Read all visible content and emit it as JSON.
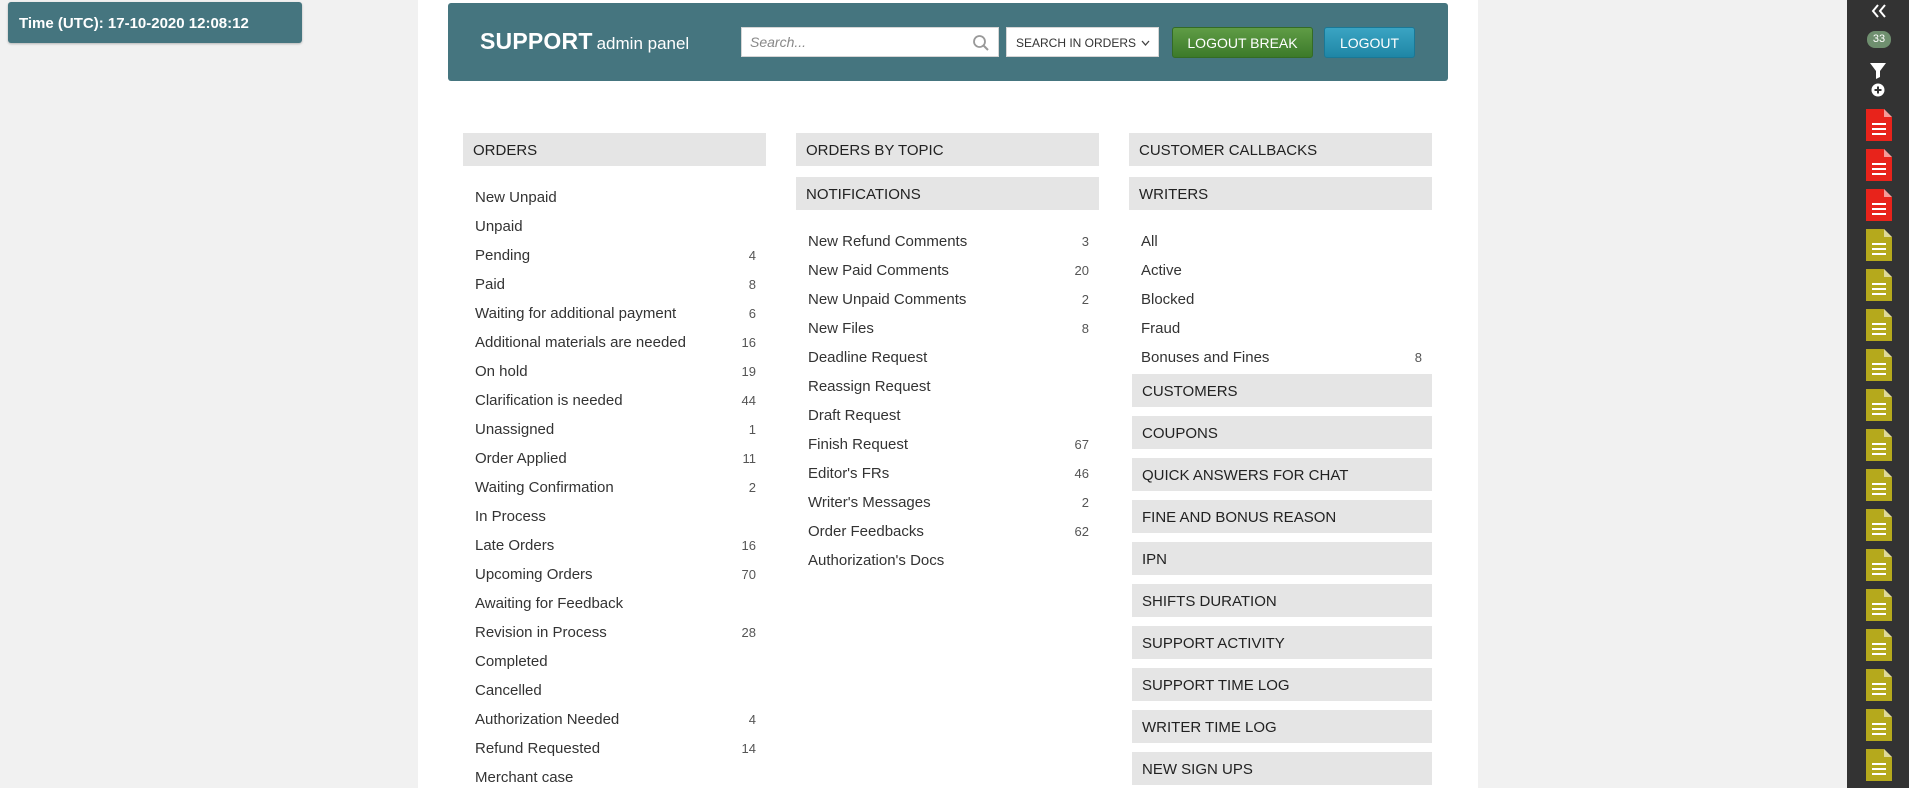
{
  "time_badge": "Time (UTC): 17-10-2020 12:08:12",
  "header": {
    "brand_main": "SUPPORT",
    "brand_sub": "admin panel",
    "search_placeholder": "Search...",
    "search_scope": "SEARCH IN ORDERS",
    "logout_break": "LOGOUT BREAK",
    "logout": "LOGOUT"
  },
  "orders": {
    "title": "ORDERS",
    "items": [
      {
        "label": "New Unpaid",
        "count": ""
      },
      {
        "label": "Unpaid",
        "count": ""
      },
      {
        "label": "Pending",
        "count": "4"
      },
      {
        "label": "Paid",
        "count": "8"
      },
      {
        "label": "Waiting for additional payment",
        "count": "6"
      },
      {
        "label": "Additional materials are needed",
        "count": "16"
      },
      {
        "label": "On hold",
        "count": "19"
      },
      {
        "label": "Clarification is needed",
        "count": "44"
      },
      {
        "label": "Unassigned",
        "count": "1"
      },
      {
        "label": "Order Applied",
        "count": "11"
      },
      {
        "label": "Waiting Confirmation",
        "count": "2"
      },
      {
        "label": "In Process",
        "count": ""
      },
      {
        "label": "Late Orders",
        "count": "16"
      },
      {
        "label": "Upcoming Orders",
        "count": "70"
      },
      {
        "label": "Awaiting for Feedback",
        "count": ""
      },
      {
        "label": "Revision in Process",
        "count": "28"
      },
      {
        "label": "Completed",
        "count": ""
      },
      {
        "label": "Cancelled",
        "count": ""
      },
      {
        "label": "Authorization Needed",
        "count": "4"
      },
      {
        "label": "Refund Requested",
        "count": "14"
      },
      {
        "label": "Merchant case",
        "count": ""
      }
    ]
  },
  "orders_by_topic": {
    "title": "ORDERS BY TOPIC"
  },
  "notifications": {
    "title": "NOTIFICATIONS",
    "items": [
      {
        "label": "New Refund Comments",
        "count": "3"
      },
      {
        "label": "New Paid Comments",
        "count": "20"
      },
      {
        "label": "New Unpaid Comments",
        "count": "2"
      },
      {
        "label": "New Files",
        "count": "8"
      },
      {
        "label": "Deadline Request",
        "count": ""
      },
      {
        "label": "Reassign Request",
        "count": ""
      },
      {
        "label": "Draft Request",
        "count": ""
      },
      {
        "label": "Finish Request",
        "count": "67"
      },
      {
        "label": "Editor's FRs",
        "count": "46"
      },
      {
        "label": "Writer's Messages",
        "count": "2"
      },
      {
        "label": "Order Feedbacks",
        "count": "62"
      },
      {
        "label": "Authorization's Docs",
        "count": ""
      }
    ]
  },
  "customer_callbacks": {
    "title": "CUSTOMER CALLBACKS"
  },
  "writers": {
    "title": "WRITERS",
    "items": [
      {
        "label": "All",
        "count": ""
      },
      {
        "label": "Active",
        "count": ""
      },
      {
        "label": "Blocked",
        "count": ""
      },
      {
        "label": "Fraud",
        "count": ""
      },
      {
        "label": "Bonuses and Fines",
        "count": "8"
      }
    ]
  },
  "other_sections": [
    "CUSTOMERS",
    "COUPONS",
    "QUICK ANSWERS FOR CHAT",
    "FINE AND BONUS REASON",
    "IPN",
    "SHIFTS DURATION",
    "SUPPORT ACTIVITY",
    "SUPPORT TIME LOG",
    "WRITER TIME LOG",
    "NEW SIGN UPS"
  ],
  "sidebar": {
    "badge_count": "33",
    "docs": [
      "red",
      "red",
      "red",
      "olive",
      "olive",
      "olive",
      "olive",
      "olive",
      "olive",
      "olive",
      "olive",
      "olive",
      "olive",
      "olive",
      "olive",
      "olive",
      "olive",
      "olive"
    ]
  },
  "colors": {
    "header": "#45757f",
    "doc_red": "#e8231b",
    "doc_olive": "#b5a91c"
  }
}
